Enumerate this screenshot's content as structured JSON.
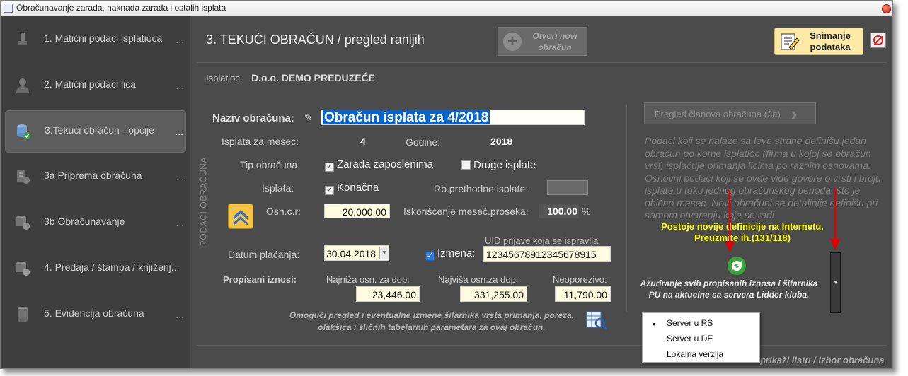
{
  "window": {
    "title": "Obračunavanje zarada, naknada zarada i ostalih isplata"
  },
  "sidebar": {
    "items": [
      {
        "label": "1. Matični podaci isplatioca",
        "dots": "..."
      },
      {
        "label": "2. Matični podaci lica",
        "dots": "..."
      },
      {
        "label": "3.Tekući obračun - opcije",
        "dots": "..."
      },
      {
        "label": "3a Priprema obračuna",
        "dots": "..."
      },
      {
        "label": "3b Obračunavanje",
        "dots": "..."
      },
      {
        "label": "4. Predaja / štampa / knjiženj...",
        "dots": ""
      },
      {
        "label": "5. Evidencija obračuna",
        "dots": "..."
      }
    ]
  },
  "header": {
    "title": "3. TEKUĆI OBRAČUN / pregled ranijih",
    "new_button": "Otvori novi obračun",
    "save_button": "Snimanje podataka"
  },
  "isplatioc": {
    "label": "Isplatioc:",
    "value": "D.o.o. DEMO PREDUZEĆE"
  },
  "form": {
    "naziv_label": "Naziv obračuna:",
    "naziv_value": "Obračun isplata za 4/2018",
    "mesec_label": "Isplata za mesec:",
    "mesec_value": "4",
    "godine_label": "Godine:",
    "godine_value": "2018",
    "tip_label": "Tip obračuna:",
    "zarada_label": "Zarada zaposlenima",
    "druge_label": "Druge isplate",
    "isplata_label": "Isplata:",
    "konacna_label": "Konačna",
    "rb_label": "Rb.prethodne isplate:",
    "osn_label": "Osn.c.r:",
    "osn_value": "20,000.00",
    "iskor_label": "Iskorišćenje meseč.proseka:",
    "iskor_value": "100.00",
    "iskor_unit": "%",
    "side_label": "PODACI OBRAČUNA",
    "uid_label": "UID prijave koja se ispravlja",
    "datum_label": "Datum plaćanja:",
    "datum_value": "30.04.2018",
    "izmena_label": "Izmena:",
    "uid_value": "12345678912345678915",
    "propisani_label": "Propisani iznosi:",
    "min_label": "Najniža osn. za dop:",
    "min_value": "23,446.00",
    "max_label": "Najviša osn.za dop:",
    "max_value": "331,255.00",
    "neop_label": "Neoporezivo:",
    "neop_value": "11,790.00",
    "hint": "Omogući pregled i eventualne izmene šifarnika vrsta primanja, poreza, olakšica i sličnih tabelarnih parametara za ovaj obračun."
  },
  "right": {
    "pregled_button": "Pregled članova obračuna (3a)",
    "description": "Podaci koji se nalaze sa leve strane definišu jedan obračun po kome isplatioc (firma u kojoj se obračun vrši) isplaćuje primanja licima po raznim osnovama. Osnovni podaci koji se ovde vide govore o vrsti i broju isplate u toku jednog obračunskog perioda, što je obično mesec. Novi obračuni se detaljnije definišu pri samom otvaranju koje se radi",
    "notice": "Postoje novije definicije na Internetu. Preuzmite ih.(131/118)",
    "update_text": "Ažuriranje svih propisanih iznosa i šifarnika PU na aktuelne sa servera Lidder kluba.",
    "footer_link": "prikaži listu / izbor obračuna"
  },
  "menu": {
    "items": [
      "Server u RS",
      "Server u DE",
      "Lokalna verzija"
    ],
    "selected": "Server u RS"
  },
  "colors": {
    "accent": "#0a64c8",
    "warning": "#ffff00",
    "save_bg": "#fde9a6",
    "arrow": "#e00000"
  }
}
